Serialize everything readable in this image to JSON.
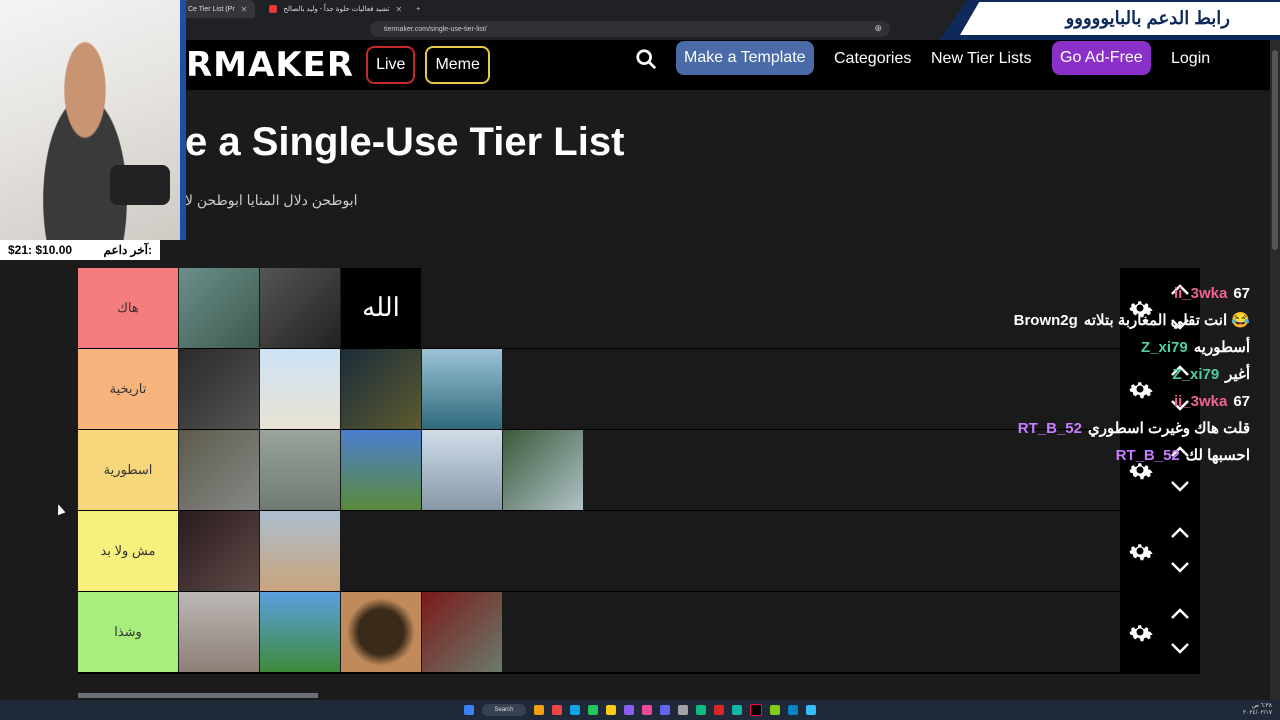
{
  "browser": {
    "tabs": [
      {
        "label": "Ce Tier List (Pr",
        "active": true
      },
      {
        "label": "تشيد فعاليات حلوة جداً - وليد بالصالح",
        "active": false
      }
    ],
    "new_tab_label": "+",
    "address": "tiermaker.com/single-use-tier-list/"
  },
  "nav": {
    "logo": "RMAKER",
    "live_label": "Live",
    "meme_label": "Meme",
    "make_template_label": "Make a Template",
    "categories_label": "Categories",
    "new_tier_lists_label": "New Tier Lists",
    "go_ad_free_label": "Go Ad-Free",
    "login_label": "Login"
  },
  "page": {
    "title": "e a Single-Use Tier List",
    "subtitle": "ابوطحن دلال المنايا ابوطحن لا"
  },
  "banner": {
    "text": "رابط الدعم بالبايووووو"
  },
  "donor": {
    "label": "آخر داعم:",
    "value": "$21: $10.00"
  },
  "tiers": [
    {
      "label": "هاك",
      "color": "#f47c7c",
      "items": [
        "landscape-lake",
        "rainy-street",
        "allah-calligraphy"
      ]
    },
    {
      "label": "تاريخية",
      "color": "#f7b37c",
      "items": [
        "night-clouds",
        "mosque-minarets",
        "palm-trees-night",
        "sea-coast"
      ]
    },
    {
      "label": "اسطورية",
      "color": "#f7d67c",
      "items": [
        "rocky-shore",
        "calm-sea",
        "palm-garden",
        "river-view",
        "waterfall-rocks"
      ]
    },
    {
      "label": "مش ولا بد",
      "color": "#f7f07c",
      "items": [
        "lecture-hall",
        "yellow-flower"
      ]
    },
    {
      "label": "وشذا",
      "color": "#a8ee7c",
      "items": [
        "snowy-desert",
        "minecraft-house",
        "coffee-cup",
        "minecraft-interior"
      ]
    }
  ],
  "chat": [
    {
      "user": "ii_3wka",
      "color": "#f06292",
      "text": "67"
    },
    {
      "user": "Brown2g",
      "color": "#ffffff",
      "text": "انت تقلي المغاربة بتلاته 😂"
    },
    {
      "user": "Z_xi79",
      "color": "#4dd0a1",
      "text": "أسطوريه"
    },
    {
      "user": "Z_xi79",
      "color": "#4dd0a1",
      "text": "أغير"
    },
    {
      "user": "ii_3wka",
      "color": "#f06292",
      "text": "67"
    },
    {
      "user": "RT_B_52",
      "color": "#c77dff",
      "text": "قلت هاك وغيرت اسطوري"
    },
    {
      "user": "RT_B_52",
      "color": "#c77dff",
      "text": "احسبها لك"
    }
  ],
  "taskbar": {
    "search_label": "Search",
    "time": "٦:٣٨ ص",
    "date": "٢٠٢٤/٠٢/١٧"
  },
  "colors": {
    "live_border": "#c62828",
    "meme_border": "#e6c84a",
    "template_bg": "#4b6aa8",
    "adfree_bg": "#8b2fc9"
  }
}
